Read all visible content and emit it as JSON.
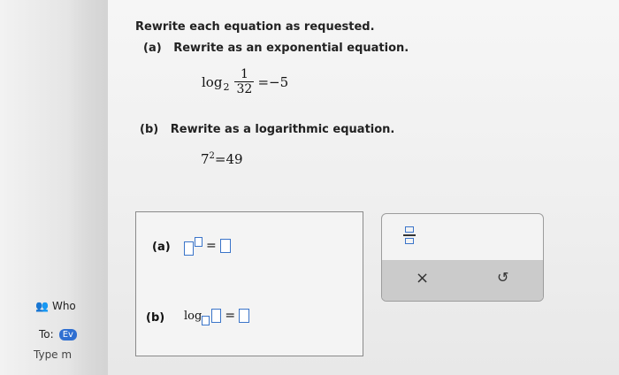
{
  "question": {
    "title": "Rewrite each equation as requested.",
    "part_a": {
      "label": "(a)",
      "prompt": "Rewrite as an exponential equation.",
      "log_text": "log",
      "base": "2",
      "numerator": "1",
      "denominator": "32",
      "rhs": "=−5"
    },
    "part_b": {
      "label": "(b)",
      "prompt": "Rewrite as a logarithmic equation.",
      "base": "7",
      "exponent": "2",
      "rhs": "=49"
    }
  },
  "answer": {
    "a_label": "(a)",
    "b_label": "(b)",
    "equals": "=",
    "log_text": "log"
  },
  "toolbar": {
    "clear_symbol": "×",
    "undo_symbol": "↺"
  },
  "sidebar": {
    "who_text": "Who",
    "to_label": "To:",
    "to_badge": "Ev",
    "type_placeholder": "Type m"
  },
  "colors": {
    "input_border": "#3a74c9",
    "badge": "#2f6fd1"
  }
}
